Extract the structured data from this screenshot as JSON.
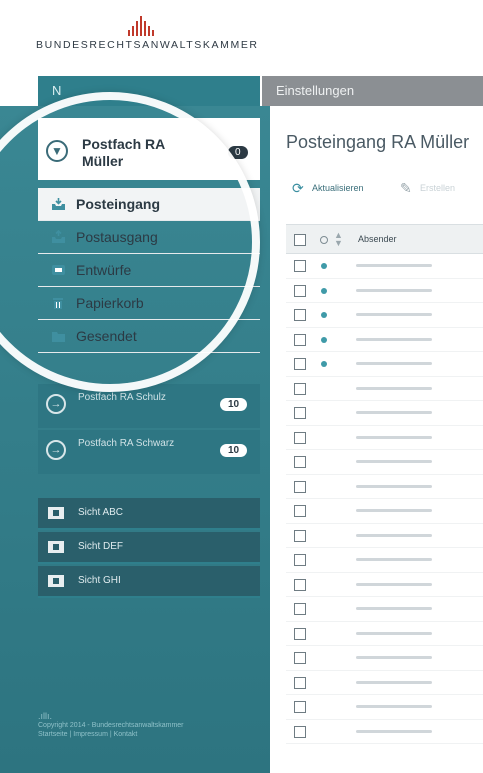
{
  "header": {
    "logo_text": "BUNDESRECHTSANWALTSKAMMER"
  },
  "topnav": {
    "tabs": [
      {
        "label": "N"
      },
      {
        "label": "Einstellungen"
      }
    ]
  },
  "sidebar": {
    "current_mailbox": {
      "title": "Postfach RA Müller",
      "count": "0"
    },
    "folders": [
      {
        "label": "Posteingang",
        "icon": "inbox-icon",
        "active": true
      },
      {
        "label": "Postausgang",
        "icon": "outbox-icon",
        "active": false
      },
      {
        "label": "Entwürfe",
        "icon": "drafts-icon",
        "active": false
      },
      {
        "label": "Papierkorb",
        "icon": "trash-icon",
        "active": false
      },
      {
        "label": "Gesendet",
        "icon": "sent-icon",
        "active": false
      }
    ],
    "other_mailboxes": [
      {
        "title": "Postfach RA Schulz",
        "count": "10"
      },
      {
        "title": "Postfach RA Schwarz",
        "count": "10"
      }
    ],
    "views": [
      {
        "label": "Sicht ABC"
      },
      {
        "label": "Sicht DEF"
      },
      {
        "label": "Sicht GHI"
      }
    ],
    "footer": {
      "copyright": "Copyright 2014 - Bundesrechtsanwaltskammer",
      "links": "Startseite | Impressum | Kontakt"
    }
  },
  "main": {
    "title": "Posteingang RA Müller",
    "toolbar": {
      "refresh_label": "Aktualisieren",
      "edit_label": "Erstellen"
    },
    "table": {
      "column_sender": "Absender",
      "unread_rows": 5,
      "total_rows": 20
    }
  },
  "colors": {
    "teal_dark": "#2e7683",
    "teal": "#3a8793",
    "tab_gray": "#8b8f93",
    "logo_red": "#c0392b",
    "unread_dot": "#3f9aa8"
  }
}
